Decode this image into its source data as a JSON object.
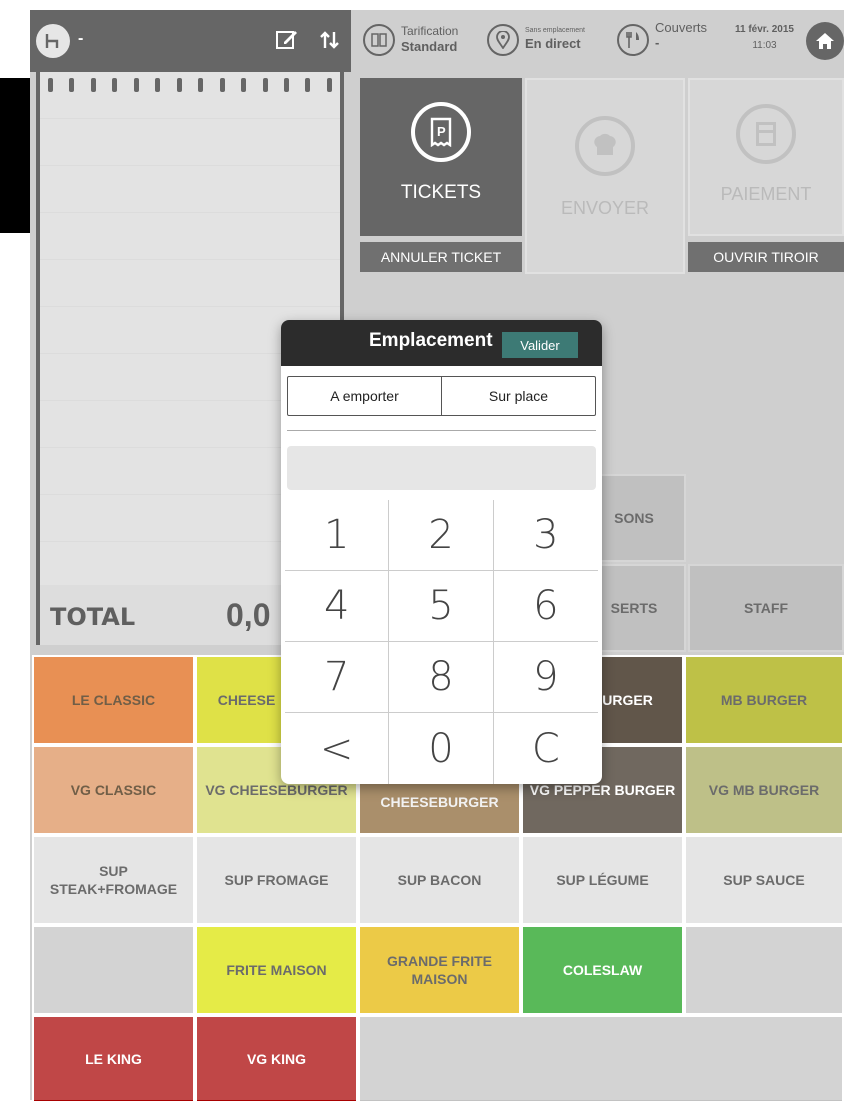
{
  "notepad": {
    "title": "-",
    "total_label": "TOTAL",
    "total_value": "0,0"
  },
  "topbar": {
    "tarif_label": "Tarification",
    "tarif_value": "Standard",
    "place_label": "Sans emplacement",
    "place_value": "En direct",
    "couverts_label": "Couverts",
    "couverts_value": "-",
    "date": "11 févr. 2015",
    "time": "11:03"
  },
  "actions": {
    "tickets": "TICKETS",
    "envoyer": "ENVOYER",
    "paiement": "PAIEMENT",
    "annuler": "ANNULER TICKET",
    "tiroir": "OUVRIR TIROIR"
  },
  "categories": {
    "boissons": "SONS",
    "desserts": "SERTS",
    "staff": "STAFF"
  },
  "grid": {
    "row1": [
      "LE CLASSIC",
      "CHEESE",
      "BURGER",
      "MB BURGER"
    ],
    "row2": [
      "VG CLASSIC",
      "VG CHEESEBURGER",
      "CHEESEBURGER",
      "VG PEPPER BURGER",
      "VG MB BURGER"
    ],
    "row3": [
      "SUP STEAK+FROMAGE",
      "SUP FROMAGE",
      "SUP BACON",
      "SUP LÉGUME",
      "SUP SAUCE"
    ],
    "row4": [
      "FRITE MAISON",
      "GRANDE FRITE MAISON",
      "COLESLAW"
    ],
    "row5": [
      "LE KING",
      "VG KING"
    ]
  },
  "modal": {
    "title": "Emplacement",
    "valider": "Valider",
    "option1": "A emporter",
    "option2": "Sur place",
    "keys": [
      "1",
      "2",
      "3",
      "4",
      "5",
      "6",
      "7",
      "8",
      "9",
      "<",
      "0",
      "C"
    ]
  },
  "colors": {
    "dark": "#2c2c2c",
    "accent": "#3d7a75"
  }
}
